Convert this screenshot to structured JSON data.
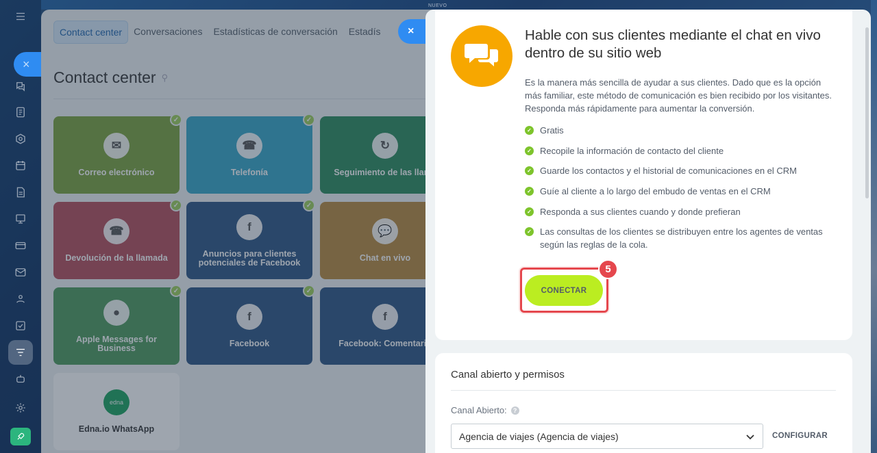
{
  "slider": {
    "close_icon": "×",
    "nuevo_badge": "NUEVO"
  },
  "contact_center": {
    "tabs": [
      {
        "label": "Contact center",
        "active": true
      },
      {
        "label": "Conversaciones",
        "active": false
      },
      {
        "label": "Estadísticas de conversación",
        "active": false
      },
      {
        "label": "Estadís",
        "active": false
      }
    ],
    "title": "Contact center",
    "tiles": [
      {
        "label": "Correo electrónico",
        "icon": "envelope-icon",
        "color": "#7ba23c",
        "checked": true
      },
      {
        "label": "Telefonía",
        "icon": "phone-icon",
        "color": "#35a6c7",
        "checked": true
      },
      {
        "label": "Seguimiento de las llama",
        "icon": "phone-sync-icon",
        "color": "#2a8a5b",
        "checked": false
      },
      {
        "label": "Devolución de la llamada",
        "icon": "phone-callback-icon",
        "color": "#b44d5a",
        "checked": true
      },
      {
        "label": "Anuncios para clientes\npotenciales de Facebook",
        "icon": "facebook-leads-icon",
        "color": "#2c5583",
        "checked": true
      },
      {
        "label": "Chat en vivo",
        "icon": "chat-icon",
        "color": "#b8893c",
        "checked": false
      },
      {
        "label": "Apple Messages for\nBusiness",
        "icon": "speech-bubble-icon",
        "color": "#4d9a5c",
        "checked": true
      },
      {
        "label": "Facebook",
        "icon": "facebook-icon",
        "color": "#2c5583",
        "checked": true
      },
      {
        "label": "Facebook: Comentario",
        "icon": "facebook-comments-icon",
        "color": "#2c5583",
        "checked": false
      },
      {
        "label": "Edna.io WhatsApp",
        "icon": "edna-logo-icon",
        "color": "#ffffff",
        "checked": false
      }
    ]
  },
  "live_chat": {
    "title": "Hable con sus clientes mediante el chat en vivo dentro de su sitio web",
    "description": "Es la manera más sencilla de ayudar a sus clientes. Dado que es la opción más familiar, este método de comunicación es bien recibido por los visitantes. Responda más rápidamente para aumentar la conversión.",
    "features": [
      "Gratis",
      "Recopile la información de contacto del cliente",
      "Guarde los contactos y el historial de comunicaciones en el CRM",
      "Guíe al cliente a lo largo del embudo de ventas en el CRM",
      "Responda a sus clientes cuando y donde prefieran",
      "Las consultas de los clientes se distribuyen entre los agentes de ventas según las reglas de la cola."
    ],
    "connect_label": "CONECTAR",
    "step_badge": "5",
    "accent_color": "#f7a700",
    "button_color": "#bbed21",
    "highlight_color": "#e5474d"
  },
  "channel": {
    "title": "Canal abierto y permisos",
    "field_label": "Canal Abierto:",
    "help_icon": "?",
    "selected": "Agencia de viajes (Agencia de viajes)",
    "configure_label": "CONFIGURAR"
  },
  "logo_text": "edna"
}
